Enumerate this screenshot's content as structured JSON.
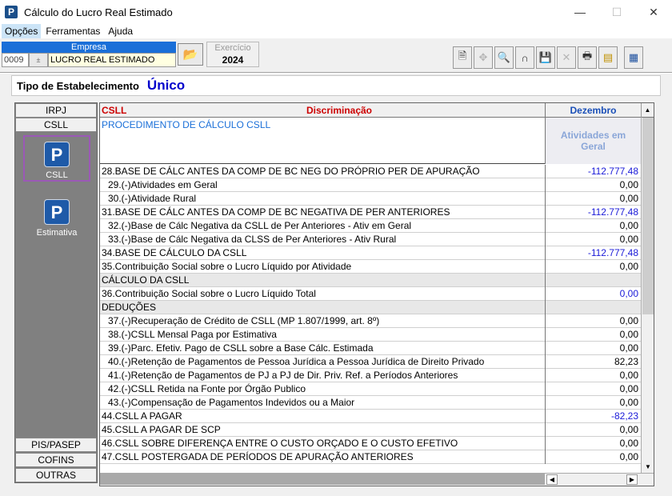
{
  "window": {
    "title": "Cálculo do Lucro Real Estimado",
    "minimize": "—",
    "maximize": "☐",
    "close": "✕"
  },
  "menu": [
    "Opções",
    "Ferramentas",
    "Ajuda"
  ],
  "empresa": {
    "label": "Empresa",
    "code": "0009",
    "name": "LUCRO REAL ESTIMADO"
  },
  "exercicio": {
    "label": "Exercício",
    "value": "2024"
  },
  "tipo": {
    "label": "Tipo de Estabelecimento",
    "value": "Único"
  },
  "left_tabs": {
    "irpj": "IRPJ",
    "csll": "CSLL",
    "pis": "PIS/PASEP",
    "cofins": "COFINS",
    "outras": "OUTRAS"
  },
  "side_buttons": {
    "csll": "CSLL",
    "estimativa": "Estimativa"
  },
  "grid": {
    "col_csll": "CSLL",
    "col_disc": "Discriminação",
    "col_month": "Dezembro",
    "procedure": "PROCEDIMENTO DE CÁLCULO CSLL",
    "activity_header": "Atividades em Geral",
    "rows": [
      {
        "desc": "28.BASE DE CÁLC ANTES DA COMP DE BC NEG DO PRÓPRIO PER DE APURAÇÃO",
        "val": "-112.777,48"
      },
      {
        "desc": "29.(-)Atividades em Geral",
        "val": "0,00"
      },
      {
        "desc": "30.(-)Atividade Rural",
        "val": "0,00"
      },
      {
        "desc": "31.BASE DE CÁLC ANTES DA COMP DE BC NEGATIVA DE PER ANTERIORES",
        "val": "-112.777,48"
      },
      {
        "desc": "32.(-)Base de Cálc Negativa da CSLL de Per Anteriores - Ativ em Geral",
        "val": "0,00"
      },
      {
        "desc": "33.(-)Base de Cálc Negativa da CLSS de Per Anteriores - Ativ Rural",
        "val": "0,00"
      },
      {
        "desc": "34.BASE DE CÁLCULO DA CSLL",
        "val": "-112.777,48"
      },
      {
        "desc": "35.Contribuição Social sobre o Lucro Líquido por Atividade",
        "val": "0,00"
      },
      {
        "desc": "CÁLCULO DA CSLL",
        "val": ""
      },
      {
        "desc": "36.Contribuição Social sobre o Lucro Líquido Total",
        "val": "0,00"
      },
      {
        "desc": "DEDUÇÕES",
        "val": ""
      },
      {
        "desc": "37.(-)Recuperação de Crédito de CSLL (MP 1.807/1999, art. 8º)",
        "val": "0,00"
      },
      {
        "desc": "38.(-)CSLL Mensal Paga por Estimativa",
        "val": "0,00"
      },
      {
        "desc": "39.(-)Parc. Efetiv. Pago de CSLL sobre a Base Cálc. Estimada",
        "val": "0,00"
      },
      {
        "desc": "40.(-)Retenção de Pagamentos de Pessoa Jurídica a Pessoa Jurídica de Direito Privado",
        "val": "82,23"
      },
      {
        "desc": "41.(-)Retenção de Pagamentos de PJ a PJ de Dir. Priv. Ref. a Períodos Anteriores",
        "val": "0,00"
      },
      {
        "desc": "42.(-)CSLL Retida na Fonte por Órgão Publico",
        "val": "0,00"
      },
      {
        "desc": "43.(-)Compensação de Pagamentos Indevidos ou a Maior",
        "val": "0,00"
      },
      {
        "desc": "44.CSLL A PAGAR",
        "val": "-82,23"
      },
      {
        "desc": "45.CSLL A PAGAR DE SCP",
        "val": "0,00"
      },
      {
        "desc": "46.CSLL SOBRE DIFERENÇA ENTRE O CUSTO ORÇADO E O CUSTO EFETIVO",
        "val": "0,00"
      },
      {
        "desc": "47.CSLL POSTERGADA DE PERÍODOS DE APURAÇÃO ANTERIORES",
        "val": "0,00"
      }
    ]
  },
  "icons": {
    "folder": "📂",
    "doc": "🗎",
    "key": "✥",
    "search": "🔍",
    "lock": "∩",
    "save": "💾",
    "delete": "✕",
    "print": "🖶",
    "stack": "▤",
    "window": "▦",
    "spin": "±",
    "up": "▲",
    "down": "▼",
    "left": "◀",
    "right": "▶",
    "app": "P"
  }
}
